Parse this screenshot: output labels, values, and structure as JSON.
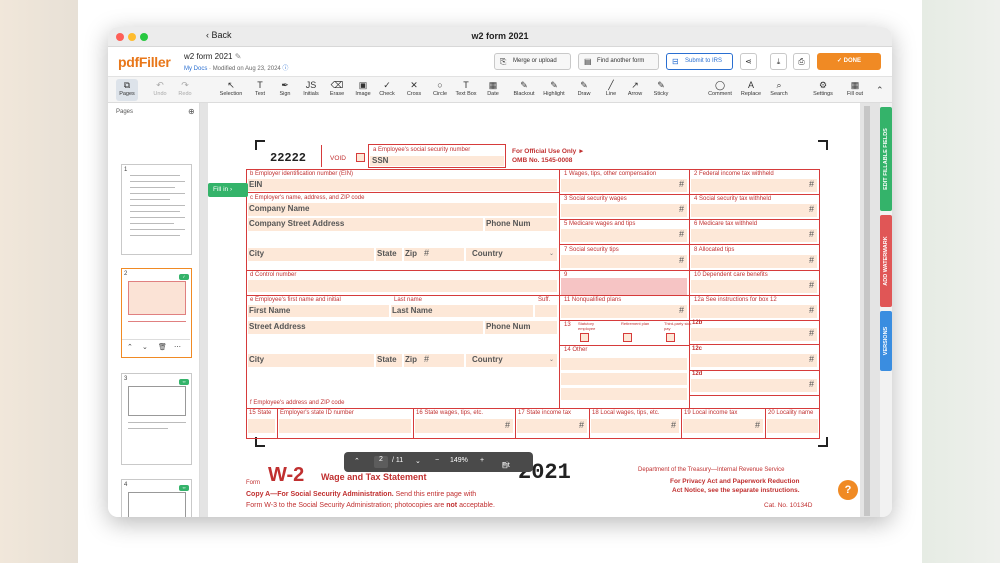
{
  "window": {
    "title": "w2 form 2021",
    "back_label": "Back"
  },
  "app": {
    "logo": "pdfFiller",
    "doc_name": "w2 form 2021",
    "my_docs": "My Docs",
    "modified": "Modified on Aug 23, 2024",
    "buttons": {
      "merge": "Merge or upload",
      "find": "Find another form",
      "submit": "Submit to IRS",
      "done": "DONE"
    }
  },
  "toolbar": [
    {
      "label": "Pages",
      "icon": "pages-icon",
      "glyph": "⧉"
    },
    {
      "label": "Undo",
      "icon": "undo-icon",
      "glyph": "↶"
    },
    {
      "label": "Redo",
      "icon": "redo-icon",
      "glyph": "↷"
    },
    {
      "label": "Selection",
      "icon": "cursor-icon",
      "glyph": "↖"
    },
    {
      "label": "Text",
      "icon": "text-icon",
      "glyph": "T"
    },
    {
      "label": "Sign",
      "icon": "sign-icon",
      "glyph": "✒"
    },
    {
      "label": "Initials",
      "icon": "initials-icon",
      "glyph": "JS"
    },
    {
      "label": "Erase",
      "icon": "eraser-icon",
      "glyph": "⌫"
    },
    {
      "label": "Image",
      "icon": "image-icon",
      "glyph": "▣"
    },
    {
      "label": "Check",
      "icon": "check-icon",
      "glyph": "✓"
    },
    {
      "label": "Cross",
      "icon": "cross-icon",
      "glyph": "✕"
    },
    {
      "label": "Circle",
      "icon": "circle-icon",
      "glyph": "○"
    },
    {
      "label": "Text Box",
      "icon": "textbox-icon",
      "glyph": "T"
    },
    {
      "label": "Date",
      "icon": "date-icon",
      "glyph": "▦"
    },
    {
      "label": "Blackout",
      "icon": "blackout-icon",
      "glyph": "✎"
    },
    {
      "label": "Highlight",
      "icon": "highlight-icon",
      "glyph": "✎"
    },
    {
      "label": "Draw",
      "icon": "draw-icon",
      "glyph": "✎"
    },
    {
      "label": "Line",
      "icon": "line-icon",
      "glyph": "╱"
    },
    {
      "label": "Arrow",
      "icon": "arrow-icon",
      "glyph": "↗"
    },
    {
      "label": "Sticky",
      "icon": "sticky-icon",
      "glyph": "✎"
    },
    {
      "label": "Comment",
      "icon": "comment-icon",
      "glyph": "◯"
    },
    {
      "label": "Replace",
      "icon": "replace-icon",
      "glyph": "A"
    },
    {
      "label": "Search",
      "icon": "search-icon",
      "glyph": "⌕"
    },
    {
      "label": "Settings",
      "icon": "gear-icon",
      "glyph": "⚙"
    },
    {
      "label": "Fill out",
      "icon": "fillout-icon",
      "glyph": "▦"
    }
  ],
  "pages_panel": {
    "header": "Pages",
    "thumbs": [
      "1",
      "2",
      "3",
      "4"
    ]
  },
  "fill_in": "Fill in",
  "side_tabs": {
    "edit": "EDIT FILLABLE FIELDS",
    "watermark": "ADD WATERMARK",
    "versions": "VERSIONS"
  },
  "zoom": {
    "page": "2",
    "total": "/ 11",
    "level": "149%",
    "fit": "Fit"
  },
  "form": {
    "code": "22222",
    "void": "VOID",
    "a_label": "a  Employee's social security number",
    "ssn": "SSN",
    "official": "For Official Use Only ►",
    "omb": "OMB No. 1545-0008",
    "b_label": "b  Employer identification number (EIN)",
    "ein": "EIN",
    "c_label": "c  Employer's name, address, and ZIP code",
    "company_name": "Company Name",
    "company_street": "Company Street Address",
    "phone": "Phone Num",
    "city": "City",
    "state": "State",
    "zip": "Zip",
    "country": "Country",
    "d_label": "d  Control number",
    "e_label": "e  Employee's first name and initial",
    "last_label": "Last name",
    "suff": "Suff.",
    "first_name": "First Name",
    "last_name": "Last Name",
    "street": "Street Address",
    "f_label": "f  Employee's address and ZIP code",
    "boxes": [
      "1   Wages, tips, other compensation",
      "2   Federal income tax withheld",
      "3   Social security wages",
      "4   Social security tax withheld",
      "5   Medicare wages and tips",
      "6   Medicare tax withheld",
      "7   Social security tips",
      "8   Allocated tips",
      "9",
      "10  Dependent care benefits",
      "11  Nonqualified plans",
      "12a  See instructions for box 12"
    ],
    "b13": "13",
    "b13_sub": [
      "Statutory employee",
      "Retirement plan",
      "Third-party sick pay"
    ],
    "b12b": "12b",
    "b12c": "12c",
    "b12d": "12d",
    "b14": "14  Other",
    "bottom": [
      "15  State",
      "Employer's state ID number",
      "16  State wages, tips, etc.",
      "17  State income tax",
      "18  Local wages, tips, etc.",
      "19  Local income tax",
      "20  Locality name"
    ],
    "hash": "#",
    "form_word": "Form",
    "w2": "W-2",
    "wage_title": "Wage and Tax Statement",
    "year": "2021",
    "copy_a": "Copy A—For Social Security Administration.",
    "copy_a_rest": "Send this entire page with",
    "w3_line": "Form W-3 to the Social Security Administration; photocopies are",
    "not": "not",
    "acceptable": "acceptable.",
    "dept": "Department of the Treasury—Internal Revenue Service",
    "privacy": "For Privacy Act and Paperwork Reduction",
    "act_notice": "Act Notice, see the separate instructions.",
    "cat": "Cat. No. 10134D"
  },
  "colors": {
    "accent": "#f08a24",
    "form_red": "#d63b3b",
    "field_fill": "#fde8d8",
    "green": "#34b36a",
    "blue": "#2a6fd1"
  }
}
